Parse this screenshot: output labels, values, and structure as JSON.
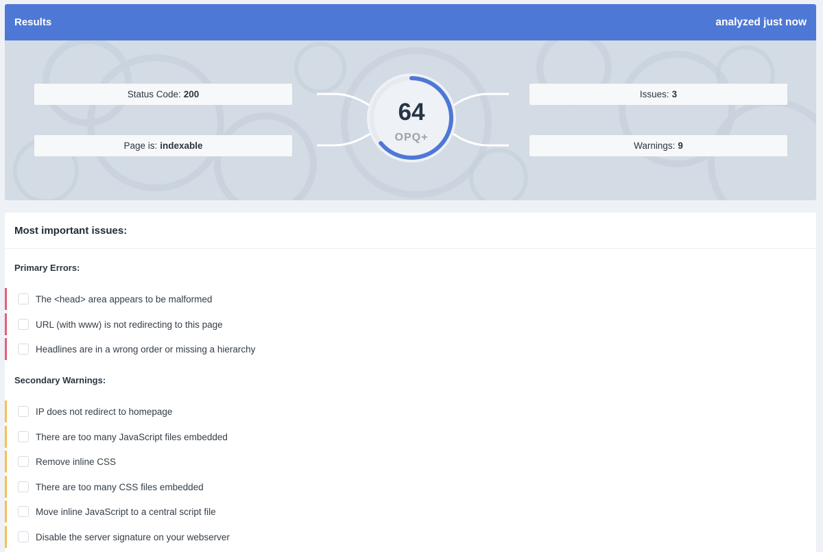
{
  "header": {
    "title": "Results",
    "analyzed": "analyzed just now"
  },
  "stats": {
    "status_code": {
      "label": "Status Code:",
      "value": "200"
    },
    "page": {
      "label": "Page is:",
      "value": "indexable"
    },
    "issues": {
      "label": "Issues:",
      "value": "3"
    },
    "warnings": {
      "label": "Warnings:",
      "value": "9"
    }
  },
  "score": {
    "value": "64",
    "label": "OPQ+",
    "progress": 0.64,
    "color": "#4e78d6"
  },
  "issues_panel": {
    "title": "Most important issues:",
    "primary_label": "Primary Errors:",
    "primary": [
      "The <head> area appears to be malformed",
      "URL (with www) is not redirecting to this page",
      "Headlines are in a wrong order or missing a hierarchy"
    ],
    "secondary_label": "Secondary Warnings:",
    "secondary": [
      "IP does not redirect to homepage",
      "There are too many JavaScript files embedded",
      "Remove inline CSS",
      "There are too many CSS files embedded",
      "Move inline JavaScript to a central script file",
      "Disable the server signature on your webserver"
    ]
  },
  "colors": {
    "header": "#4e78d6",
    "error": "#e85d75",
    "warning": "#f6c04f"
  }
}
